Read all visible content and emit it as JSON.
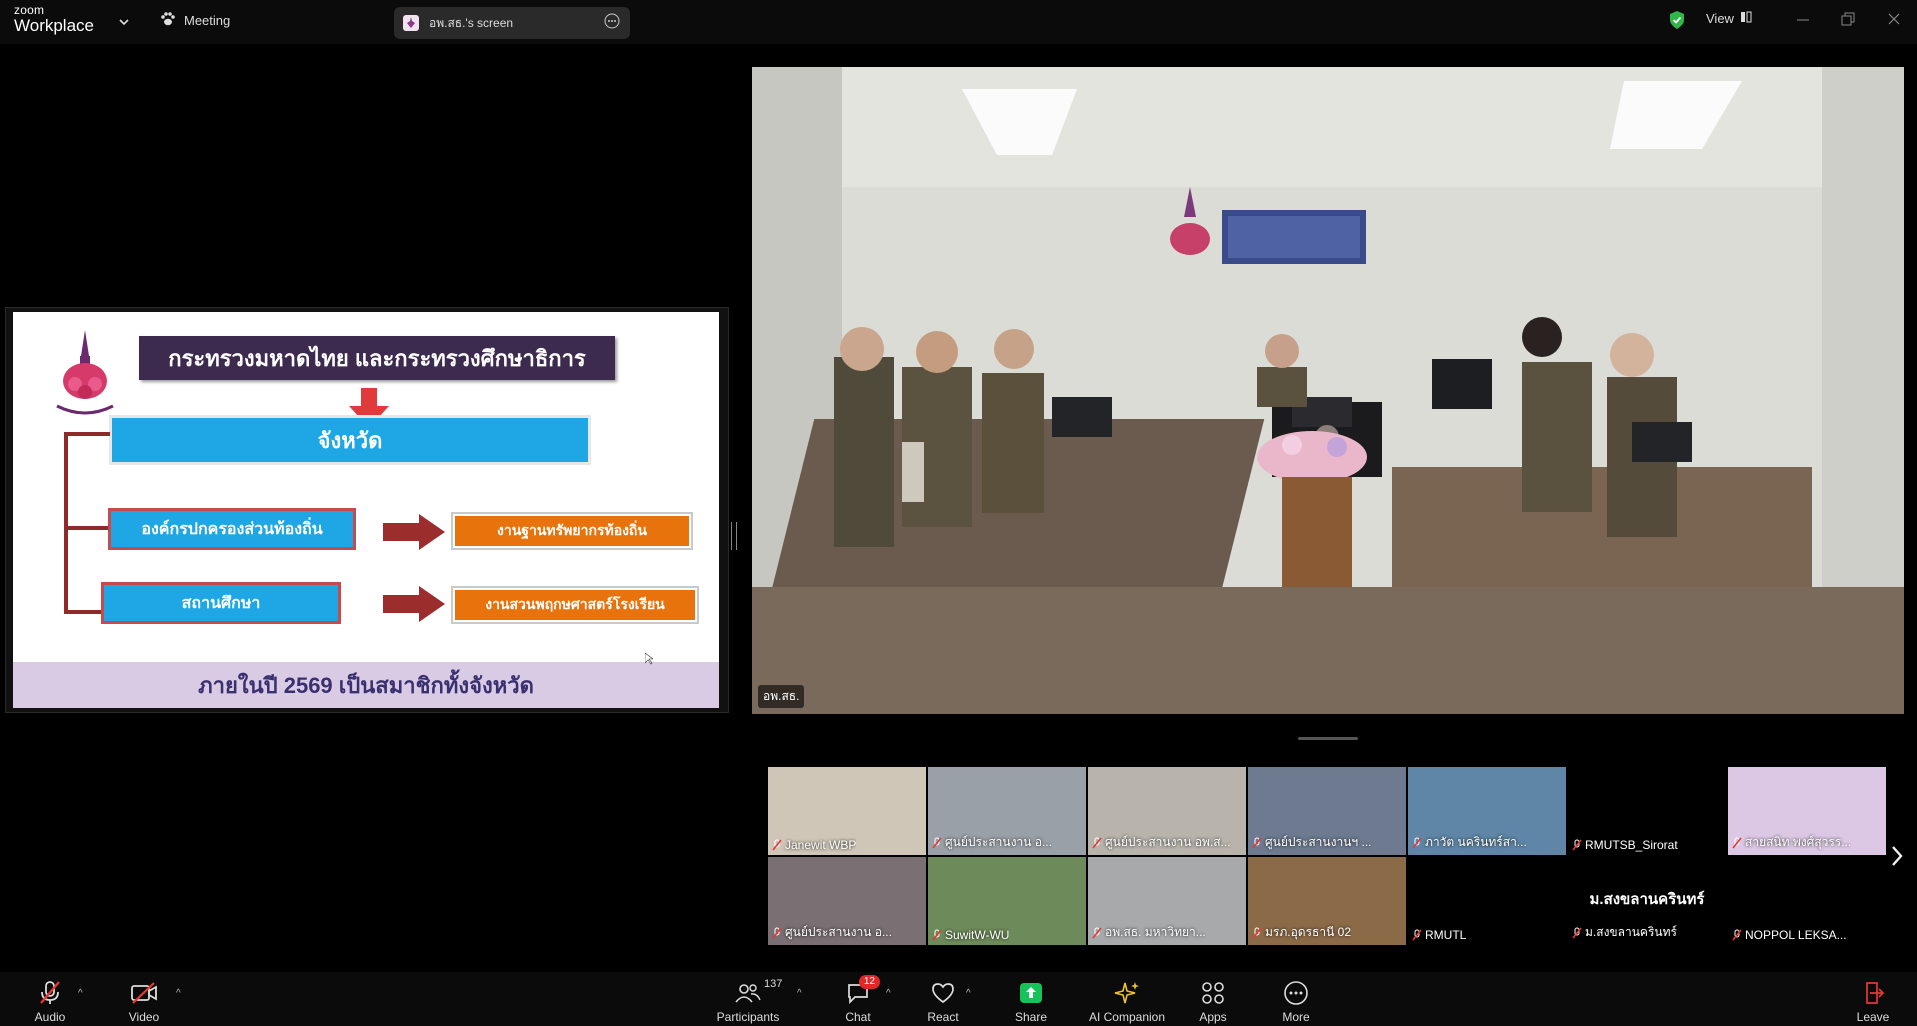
{
  "app": {
    "brand_top": "zoom",
    "brand_bottom": "Workplace"
  },
  "topbar": {
    "meeting_label": "Meeting",
    "share_title": "อพ.สธ.'s screen",
    "view_label": "View",
    "security_color": "#2fb84a"
  },
  "slide": {
    "title": "กระทรวงมหาดไทย และกระทรวงศึกษาธิการ",
    "province": "จังหวัด",
    "local_admin": "องค์กรปกครองส่วนท้องถิ่น",
    "local_resource": "งานฐานทรัพยากรท้องถิ่น",
    "school": "สถานศึกษา",
    "school_garden": "งานสวนพฤกษศาสตร์โรงเรียน",
    "footer": "ภายในปี 2569 เป็นสมาชิกทั้งจังหวัด"
  },
  "speaker": {
    "name": "อพ.สธ."
  },
  "gallery": {
    "tiles": [
      {
        "name": "Janewit WBP",
        "bg": "#cfc6b8"
      },
      {
        "name": "ศูนย์ประสานงาน อ...",
        "bg": "#9aa0a8"
      },
      {
        "name": "ศูนย์ประสานงาน อพ.ส...",
        "bg": "#b8b4ac"
      },
      {
        "name": "ศูนย์ประสานงานฯ ...",
        "bg": "#6d7a90"
      },
      {
        "name": "ภาวัต นครินทร์สา...",
        "bg": "#5f86a6"
      },
      {
        "name": "RMUTSB_Sirorat",
        "bg": "#000000"
      },
      {
        "name": "สายสนิท พงศ์สุวรร...",
        "bg": "#dcc8e4"
      },
      {
        "name": "ศูนย์ประสานงาน อ...",
        "bg": "#7a6f72"
      },
      {
        "name": "SuwitW-WU",
        "bg": "#6d8a5a"
      },
      {
        "name": "อพ.สธ. มหาวิทยา...",
        "bg": "#a7a9aa"
      },
      {
        "name": "มรภ.อุดรธานี 02",
        "bg": "#8b6a48"
      },
      {
        "name": "RMUTL",
        "bg": "#000000"
      },
      {
        "name": "ม.สงขลานครินทร์",
        "bg": "#000000",
        "label": "ม.สงขลานครินทร์"
      },
      {
        "name": "NOPPOL LEKSA...",
        "bg": "#000000"
      }
    ]
  },
  "toolbar": {
    "audio": "Audio",
    "video": "Video",
    "participants": "Participants",
    "participants_count": "137",
    "chat": "Chat",
    "chat_badge": "12",
    "react": "React",
    "share": "Share",
    "ai_companion": "AI Companion",
    "apps": "Apps",
    "more": "More",
    "leave": "Leave",
    "share_color": "#16c25a",
    "leave_color": "#e53935"
  }
}
